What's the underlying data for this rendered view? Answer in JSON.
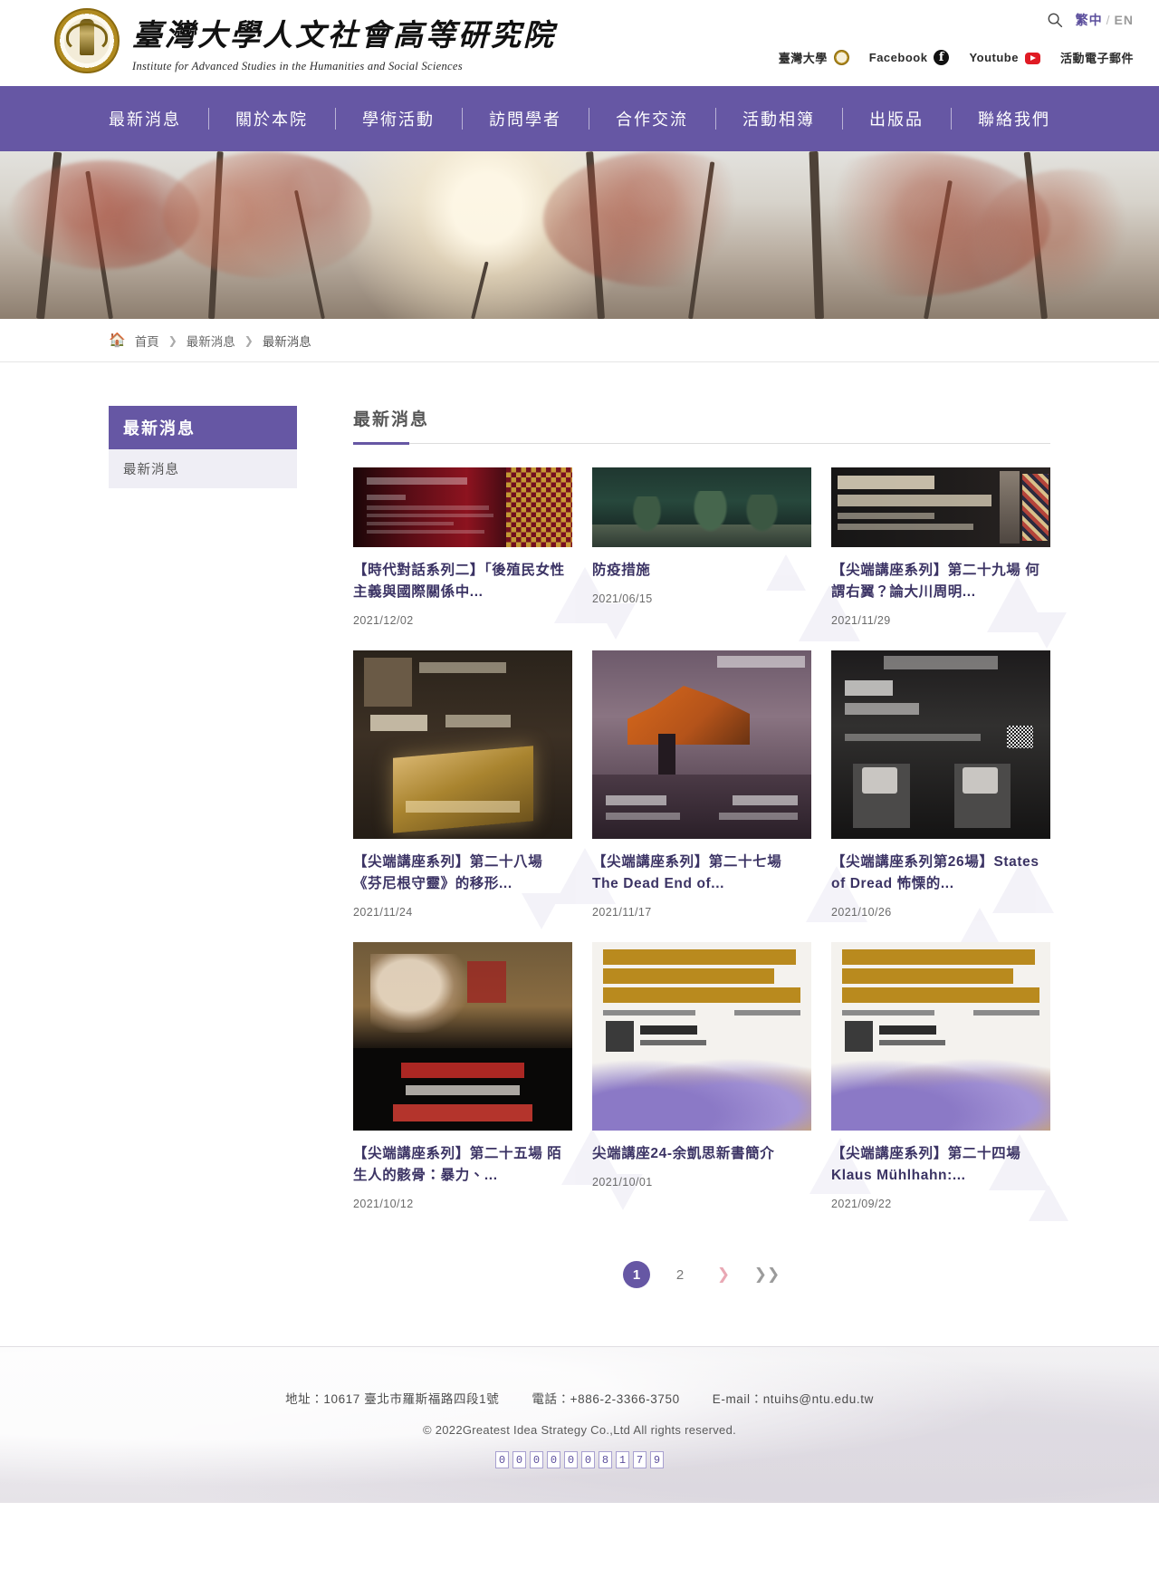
{
  "site": {
    "logo_cn": "臺灣大學人文社會高等研究院",
    "logo_en": "Institute for Advanced Studies in the Humanities and Social Sciences",
    "seal_name": "ntu-seal-logo"
  },
  "utility": {
    "search_label": "search-icon",
    "lang_zh": "繁中",
    "lang_sep": "/",
    "lang_en": "EN",
    "links": [
      {
        "label": "臺灣大學",
        "icon": "ntu-seal-icon"
      },
      {
        "label": "Facebook",
        "icon": "facebook-icon"
      },
      {
        "label": "Youtube",
        "icon": "youtube-icon"
      },
      {
        "label": "活動電子郵件",
        "icon": "none"
      }
    ]
  },
  "nav": {
    "items": [
      "最新消息",
      "關於本院",
      "學術活動",
      "訪問學者",
      "合作交流",
      "活動相簿",
      "出版品",
      "聯絡我們"
    ]
  },
  "breadcrumb": {
    "home_icon": "home-icon",
    "items": [
      "首頁",
      "最新消息",
      "最新消息"
    ],
    "separator": "❯"
  },
  "sidebar": {
    "heading": "最新消息",
    "items": [
      "最新消息"
    ]
  },
  "main": {
    "title": "最新消息",
    "cards": [
      {
        "title": "【時代對話系列二】「後殖民女性主義與國際關係中...",
        "date": "2021/12/02",
        "thumb": "poster-dark-red-seminar",
        "thumb_style": "short"
      },
      {
        "title": "防疫措施",
        "date": "2021/06/15",
        "thumb": "photo-trees-pond",
        "thumb_style": "short"
      },
      {
        "title": "【尖端講座系列】第二十九場 何謂右翼？論大川周明...",
        "date": "2021/11/29",
        "thumb": "poster-what-is-a-right-winger",
        "thumb_style": "short"
      },
      {
        "title": "【尖端講座系列】第二十八場 《芬尼根守靈》的移形...",
        "date": "2021/11/24",
        "thumb": "poster-finnegans-wake",
        "thumb_style": "tall"
      },
      {
        "title": "【尖端講座系列】第二十七場 The Dead End of...",
        "date": "2021/11/17",
        "thumb": "poster-bilingualism-excavator",
        "thumb_style": "tall"
      },
      {
        "title": "【尖端講座系列第26場】States of Dread 怖慄的...",
        "date": "2021/10/26",
        "thumb": "poster-states-of-dread",
        "thumb_style": "tall"
      },
      {
        "title": "【尖端講座系列】第二十五場 陌生人的骸骨：暴力、...",
        "date": "2021/10/12",
        "thumb": "poster-bones-of-strangers",
        "thumb_style": "tall"
      },
      {
        "title": "尖端講座24-余凱思新書簡介",
        "date": "2021/10/01",
        "thumb": "poster-klaus-muhlhahn",
        "thumb_style": "tall"
      },
      {
        "title": "【尖端講座系列】第二十四場 Klaus Mühlhahn:...",
        "date": "2021/09/22",
        "thumb": "poster-klaus-muhlhahn-2",
        "thumb_style": "tall"
      }
    ]
  },
  "pagination": {
    "pages": [
      "1",
      "2"
    ],
    "current": "1",
    "next_label": "❯",
    "last_label": "❯❯"
  },
  "footer": {
    "address": "地址：10617 臺北市羅斯福路四段1號",
    "phone": "電話：+886-2-3366-3750",
    "email": "E-mail：ntuihs@ntu.edu.tw",
    "copyright": "© 2022Greatest Idea Strategy Co.,Ltd All rights reserved.",
    "counter": [
      "0",
      "0",
      "0",
      "0",
      "0",
      "0",
      "8",
      "1",
      "7",
      "9"
    ]
  },
  "colors": {
    "brand_purple": "#6657a4",
    "title_purple": "#3b3364",
    "sidebar_tint": "#efeef5"
  }
}
